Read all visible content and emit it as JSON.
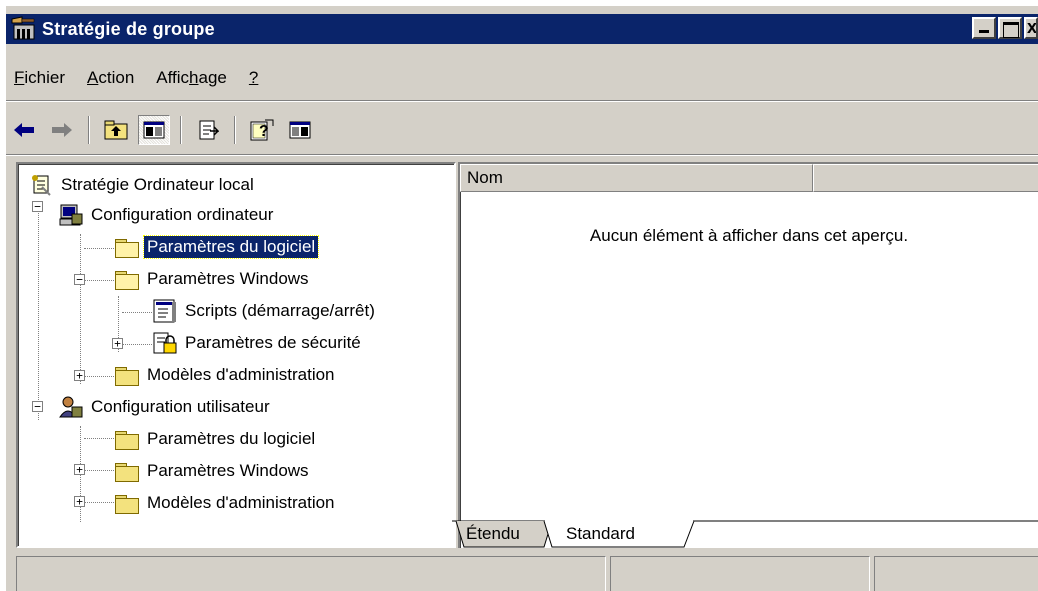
{
  "window": {
    "title": "Stratégie de groupe",
    "close_glyph": "x"
  },
  "menu": {
    "fichier": {
      "accel": "F",
      "rest": "ichier"
    },
    "action": {
      "accel": "A",
      "rest": "ction"
    },
    "affichage": {
      "pre": "Affic",
      "accel": "h",
      "rest": "age"
    },
    "help": {
      "accel": "?"
    }
  },
  "toolbar": {
    "back_icon": "back-arrow-icon",
    "forward_icon": "forward-arrow-icon"
  },
  "tree": {
    "root": "Stratégie Ordinateur local",
    "computer_config": "Configuration ordinateur",
    "cc_software": "Paramètres du logiciel",
    "cc_windows": "Paramètres Windows",
    "cc_scripts": "Scripts (démarrage/arrêt)",
    "cc_security": "Paramètres de sécurité",
    "cc_admin": "Modèles d'administration",
    "user_config": "Configuration utilisateur",
    "uc_software": "Paramètres du logiciel",
    "uc_windows": "Paramètres Windows",
    "uc_admin": "Modèles d'administration",
    "selected": "cc_software",
    "expander_plus": "+",
    "expander_minus": "−"
  },
  "list": {
    "columns": [
      "Nom",
      ""
    ],
    "empty_message": "Aucun élément à afficher dans cet aperçu."
  },
  "tabs": [
    {
      "label": "Étendu",
      "active": false
    },
    {
      "label": "Standard",
      "active": true
    }
  ],
  "status": {
    "panes": [
      "",
      "",
      ""
    ]
  },
  "colors": {
    "title_bar": "#0a246a",
    "face": "#d4d0c8",
    "selection": "#0a246a",
    "folder": "#f3e27e"
  }
}
